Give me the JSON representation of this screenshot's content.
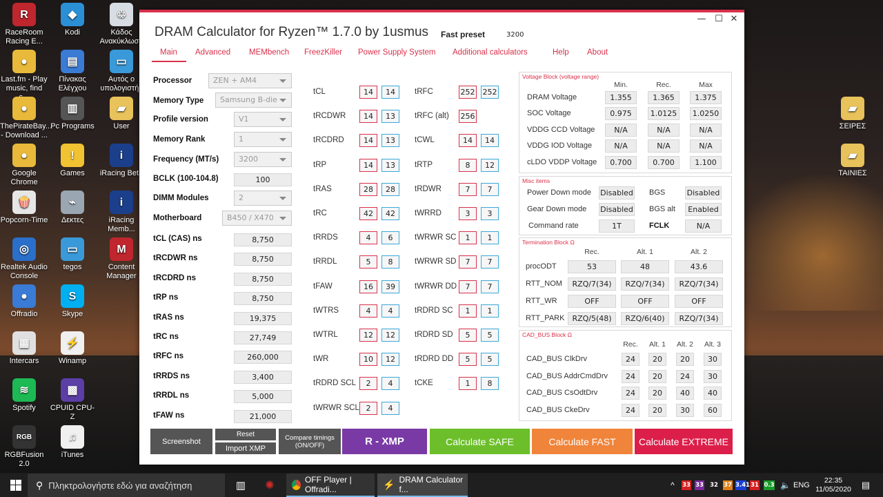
{
  "desktop": {
    "icons_left": [
      {
        "label": "RaceRoom Racing E...",
        "icon": "raceroom-icon",
        "color": "#c0262e",
        "glyph": "R"
      },
      {
        "label": "Last.fm - Play music, find s...",
        "icon": "chrome-icon",
        "color": "#e8b93a",
        "glyph": "●"
      },
      {
        "label": "ThePirateBay... - Download ...",
        "icon": "chrome-icon",
        "color": "#e8b93a",
        "glyph": "●"
      },
      {
        "label": "Google Chrome",
        "icon": "chrome-icon",
        "color": "#e8b93a",
        "glyph": "●"
      },
      {
        "label": "Popcorn-Time",
        "icon": "popcorn-icon",
        "color": "#e6e6e6",
        "glyph": "🍿"
      },
      {
        "label": "Realtek Audio Console",
        "icon": "realtek-icon",
        "color": "#2a6fc9",
        "glyph": "◎"
      },
      {
        "label": "Offradio",
        "icon": "chrome-icon",
        "color": "#3a7bd5",
        "glyph": "●"
      },
      {
        "label": "Intercars",
        "icon": "intercars-icon",
        "color": "#e0e0e0",
        "glyph": "▦"
      },
      {
        "label": "Spotify",
        "icon": "spotify-icon",
        "color": "#1db954",
        "glyph": "≋"
      },
      {
        "label": "RGBFusion 2.0",
        "icon": "rgbfusion-icon",
        "color": "#333333",
        "glyph": "RGB"
      }
    ],
    "icons_mid": [
      {
        "label": "Kodi",
        "icon": "kodi-icon",
        "color": "#2b8fd6",
        "glyph": "◆"
      },
      {
        "label": "Πίνακας Ελέγχου",
        "icon": "control-panel-icon",
        "color": "#3a7bd5",
        "glyph": "▤"
      },
      {
        "label": "Pc Programs",
        "icon": "chip-icon",
        "color": "#555555",
        "glyph": "▥"
      },
      {
        "label": "Games",
        "icon": "warning-icon",
        "color": "#f1c232",
        "glyph": "!"
      },
      {
        "label": "Δεκτες",
        "icon": "satellite-icon",
        "color": "#9aa6b2",
        "glyph": "⌁"
      },
      {
        "label": "tegos",
        "icon": "computer-icon",
        "color": "#3a9ad9",
        "glyph": "▭"
      },
      {
        "label": "Skype",
        "icon": "skype-icon",
        "color": "#00aff0",
        "glyph": "S"
      },
      {
        "label": "Winamp",
        "icon": "winamp-icon",
        "color": "#f0f0f0",
        "glyph": "⚡"
      },
      {
        "label": "CPUID CPU-Z",
        "icon": "cpuz-icon",
        "color": "#5b3fa6",
        "glyph": "▩"
      },
      {
        "label": "iTunes",
        "icon": "itunes-icon",
        "color": "#f0f0f0",
        "glyph": "♫"
      }
    ],
    "icons_right": [
      {
        "label": "Κάδος Ανακύκλωση",
        "icon": "recycle-bin-icon",
        "color": "#d8dde3",
        "glyph": "♲"
      },
      {
        "label": "Αυτός ο υπολογιστής",
        "icon": "computer-icon",
        "color": "#3a9ad9",
        "glyph": "▭"
      },
      {
        "label": "User",
        "icon": "folder-icon",
        "color": "#e8c25a",
        "glyph": "▰"
      },
      {
        "label": "iRacing Beta",
        "icon": "iracing-icon",
        "color": "#1c3f8c",
        "glyph": "i"
      },
      {
        "label": "iRacing Memb...",
        "icon": "iracing-icon",
        "color": "#1c3f8c",
        "glyph": "i"
      },
      {
        "label": "Content Manager",
        "icon": "content-manager-icon",
        "color": "#c0262e",
        "glyph": "M"
      }
    ],
    "icons_far_right": [
      {
        "label": "ΣΕΙΡΕΣ",
        "icon": "folder-icon",
        "color": "#e8c25a",
        "glyph": "▰"
      },
      {
        "label": "ΤΑΙΝΙΕΣ",
        "icon": "folder-icon",
        "color": "#e8c25a",
        "glyph": "▰"
      }
    ]
  },
  "window": {
    "title": "DRAM Calculator for Ryzen™ 1.7.0 by 1usmus",
    "preset_label": "Fast preset",
    "preset_freq": "3200",
    "controls": {
      "minimize": "—",
      "maximize": "☐",
      "close": "✕"
    },
    "menu": [
      "Main",
      "Advanced",
      "MEMbench",
      "FreezKiller",
      "Power Supply System",
      "Additional calculators",
      "Help",
      "About"
    ]
  },
  "settings": {
    "processor": {
      "label": "Processor",
      "value": "ZEN + AM4"
    },
    "memory_type": {
      "label": "Memory Type",
      "value": "Samsung B-die"
    },
    "profile_version": {
      "label": "Profile version",
      "value": "V1"
    },
    "memory_rank": {
      "label": "Memory Rank",
      "value": "1"
    },
    "frequency": {
      "label": "Frequency (MT/s)",
      "value": "3200"
    },
    "bclk": {
      "label": "BCLK (100-104.8)",
      "value": "100"
    },
    "dimm_modules": {
      "label": "DIMM Modules",
      "value": "2"
    },
    "motherboard": {
      "label": "Motherboard",
      "value": "B450 / X470"
    },
    "ns": [
      {
        "label": "tCL (CAS) ns",
        "value": "8,750"
      },
      {
        "label": "tRCDWR ns",
        "value": "8,750"
      },
      {
        "label": "tRCDRD ns",
        "value": "8,750"
      },
      {
        "label": "tRP ns",
        "value": "8,750"
      },
      {
        "label": "tRAS ns",
        "value": "19,375"
      },
      {
        "label": "tRC ns",
        "value": "27,749"
      },
      {
        "label": "tRFC ns",
        "value": "260,000"
      },
      {
        "label": "tRRDS ns",
        "value": "3,400"
      },
      {
        "label": "tRRDL ns",
        "value": "5,000"
      },
      {
        "label": "tFAW ns",
        "value": "21,000"
      }
    ]
  },
  "timings_left": [
    {
      "name": "tCL",
      "a": "14",
      "b": "14"
    },
    {
      "name": "tRCDWR",
      "a": "14",
      "b": "13"
    },
    {
      "name": "tRCDRD",
      "a": "14",
      "b": "13"
    },
    {
      "name": "tRP",
      "a": "14",
      "b": "13"
    },
    {
      "name": "tRAS",
      "a": "28",
      "b": "28"
    },
    {
      "name": "tRC",
      "a": "42",
      "b": "42"
    },
    {
      "name": "tRRDS",
      "a": "4",
      "b": "6"
    },
    {
      "name": "tRRDL",
      "a": "5",
      "b": "8"
    },
    {
      "name": "tFAW",
      "a": "16",
      "b": "39"
    },
    {
      "name": "tWTRS",
      "a": "4",
      "b": "4"
    },
    {
      "name": "tWTRL",
      "a": "12",
      "b": "12"
    },
    {
      "name": "tWR",
      "a": "10",
      "b": "12"
    },
    {
      "name": "tRDRD SCL",
      "a": "2",
      "b": "4"
    },
    {
      "name": "tWRWR SCL",
      "a": "2",
      "b": "4"
    }
  ],
  "timings_right": [
    {
      "name": "tRFC",
      "a": "252",
      "b": "252"
    },
    {
      "name": "tRFC (alt)",
      "a": "256",
      "b": ""
    },
    {
      "name": "tCWL",
      "a": "14",
      "b": "14"
    },
    {
      "name": "tRTP",
      "a": "8",
      "b": "12"
    },
    {
      "name": "tRDWR",
      "a": "7",
      "b": "7"
    },
    {
      "name": "tWRRD",
      "a": "3",
      "b": "3"
    },
    {
      "name": "tWRWR SC",
      "a": "1",
      "b": "1"
    },
    {
      "name": "tWRWR SD",
      "a": "7",
      "b": "7"
    },
    {
      "name": "tWRWR DD",
      "a": "7",
      "b": "7"
    },
    {
      "name": "tRDRD SC",
      "a": "1",
      "b": "1"
    },
    {
      "name": "tRDRD SD",
      "a": "5",
      "b": "5"
    },
    {
      "name": "tRDRD DD",
      "a": "5",
      "b": "5"
    },
    {
      "name": "tCKE",
      "a": "1",
      "b": "8"
    }
  ],
  "voltage_block": {
    "title": "Voltage Block (voltage range)",
    "headers": [
      "Min.",
      "Rec.",
      "Max"
    ],
    "rows": [
      {
        "label": "DRAM Voltage",
        "values": [
          "1.355",
          "1.365",
          "1.375"
        ]
      },
      {
        "label": "SOC Voltage",
        "values": [
          "0.975",
          "1.0125",
          "1.0250"
        ]
      },
      {
        "label": "VDDG  CCD Voltage",
        "values": [
          "N/A",
          "N/A",
          "N/A"
        ]
      },
      {
        "label": "VDDG  IOD Voltage",
        "values": [
          "N/A",
          "N/A",
          "N/A"
        ]
      },
      {
        "label": "cLDO VDDP Voltage",
        "values": [
          "0.700",
          "0.700",
          "1.100"
        ]
      }
    ]
  },
  "misc_block": {
    "title": "Misc items",
    "power_down_label": "Power Down mode",
    "power_down_value": "Disabled",
    "bgs_label": "BGS",
    "bgs_value": "Disabled",
    "gear_down_label": "Gear Down mode",
    "gear_down_value": "Disabled",
    "bgs_alt_label": "BGS alt",
    "bgs_alt_value": "Enabled",
    "command_rate_label": "Command rate",
    "command_rate_value": "1T",
    "fclk_label": "FCLK",
    "fclk_value": "N/A"
  },
  "termination_block": {
    "title": "Termination Block Ω",
    "headers": [
      "Rec.",
      "Alt. 1",
      "Alt. 2"
    ],
    "rows": [
      {
        "label": "procODT",
        "values": [
          "53",
          "48",
          "43.6"
        ]
      },
      {
        "label": "RTT_NOM",
        "values": [
          "RZQ/7(34)",
          "RZQ/7(34)",
          "RZQ/7(34)"
        ]
      },
      {
        "label": "RTT_WR",
        "values": [
          "OFF",
          "OFF",
          "OFF"
        ]
      },
      {
        "label": "RTT_PARK",
        "values": [
          "RZQ/5(48)",
          "RZQ/6(40)",
          "RZQ/7(34)"
        ]
      }
    ]
  },
  "cad_block": {
    "title": "CAD_BUS Block Ω",
    "headers": [
      "Rec.",
      "Alt. 1",
      "Alt. 2",
      "Alt. 3"
    ],
    "rows": [
      {
        "label": "CAD_BUS ClkDrv",
        "values": [
          "24",
          "20",
          "20",
          "30"
        ]
      },
      {
        "label": "CAD_BUS AddrCmdDrv",
        "values": [
          "24",
          "20",
          "24",
          "30"
        ]
      },
      {
        "label": "CAD_BUS CsOdtDrv",
        "values": [
          "24",
          "20",
          "40",
          "40"
        ]
      },
      {
        "label": "CAD_BUS CkeDrv",
        "values": [
          "24",
          "20",
          "30",
          "60"
        ]
      }
    ]
  },
  "buttons": {
    "screenshot": "Screenshot",
    "reset": "Reset",
    "import_xmp": "Import XMP",
    "compare_timings": "Compare timings (ON/OFF)",
    "r_xmp": "R - XMP",
    "calc_safe": "Calculate SAFE",
    "calc_fast": "Calculate FAST",
    "calc_extreme": "Calculate EXTREME"
  },
  "taskbar": {
    "search_placeholder": "Πληκτρολογήστε εδώ για αναζήτηση",
    "apps": [
      {
        "label": "OFF Player | Offradi...",
        "icon": "chrome-icon"
      },
      {
        "label": "DRAM Calculator f...",
        "icon": "dram-calculator-icon"
      }
    ],
    "tray_values": [
      {
        "text": "33",
        "color": "#d32020"
      },
      {
        "text": "33",
        "color": "#7a2a9a"
      },
      {
        "text": "32",
        "color": "transparent"
      },
      {
        "text": "37",
        "color": "#e0801a"
      },
      {
        "text": "3.41",
        "color": "#1a3fd8"
      },
      {
        "text": "31",
        "color": "#d32020"
      },
      {
        "text": "0.3",
        "color": "#1a9a2a"
      }
    ],
    "language": "ENG",
    "time": "22:35",
    "date": "11/05/2020"
  }
}
